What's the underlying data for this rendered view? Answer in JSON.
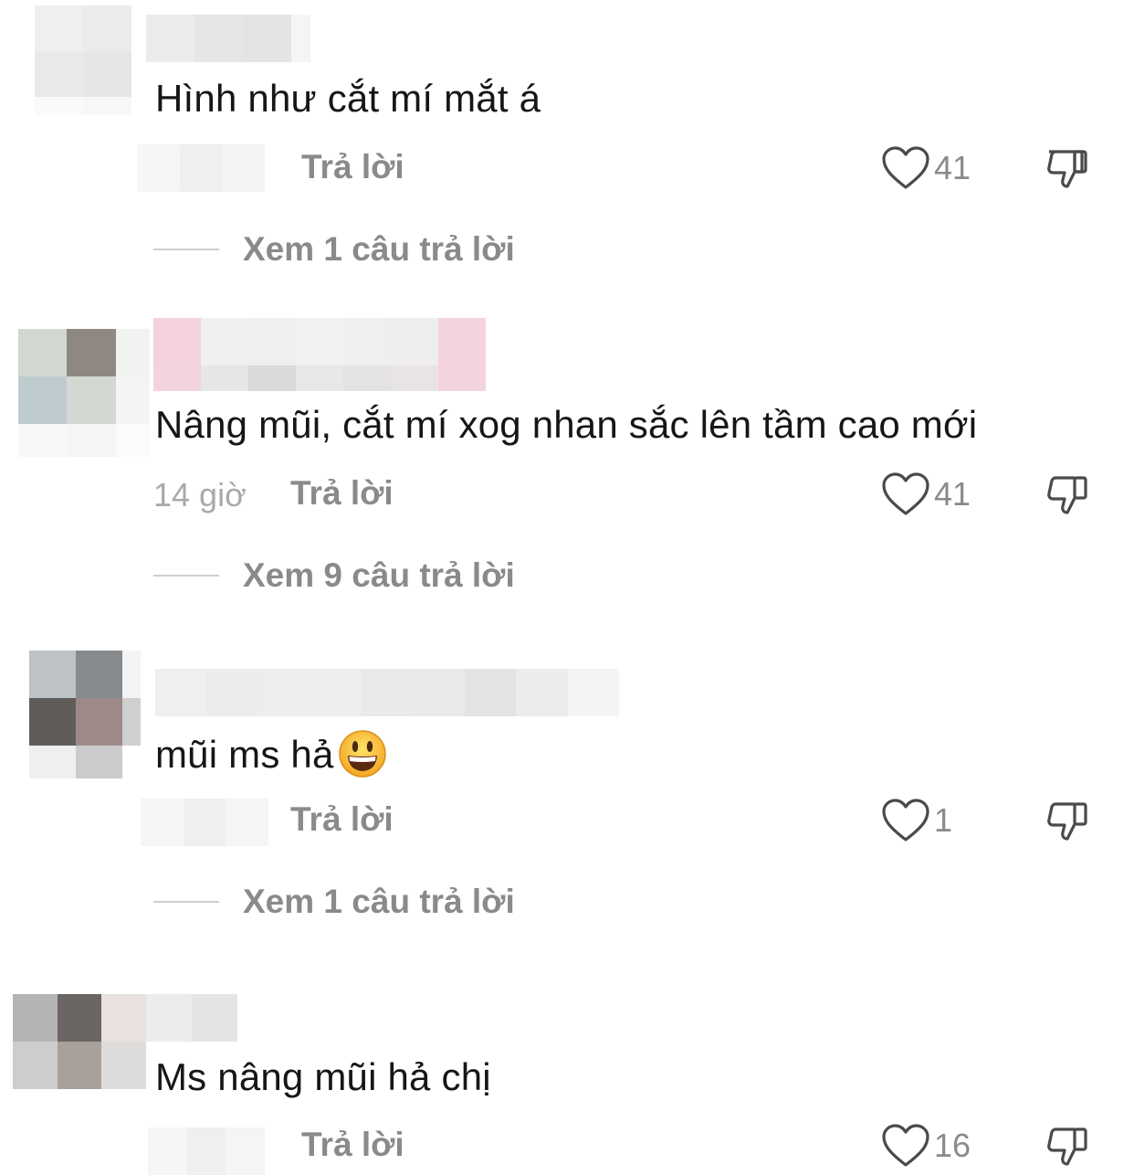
{
  "comments": [
    {
      "text": "Hình như cắt mí mắt á",
      "time": "",
      "reply_label": "Trả lời",
      "likes": "41",
      "view_replies": "Xem 1 câu trả lời"
    },
    {
      "text": "Nâng mũi, cắt mí xog nhan sắc lên tầm cao mới",
      "time": "14 giờ",
      "reply_label": "Trả lời",
      "likes": "41",
      "view_replies": "Xem 9 câu trả lời"
    },
    {
      "text": "mũi ms hả",
      "time": "",
      "reply_label": "Trả lời",
      "likes": "1",
      "view_replies": "Xem 1 câu trả lời"
    },
    {
      "text": "Ms nâng mũi hả chị",
      "time": "",
      "reply_label": "Trả lời",
      "likes": "16",
      "view_replies": ""
    }
  ],
  "icons": {
    "like": "heart-outline-icon",
    "dislike": "thumbs-down-outline-icon",
    "emoji": "grinning-face-emoji"
  },
  "colors": {
    "text": "#161616",
    "secondary": "#8a8a8a",
    "time": "#a9a9a9",
    "divider": "#cfcfcf"
  }
}
